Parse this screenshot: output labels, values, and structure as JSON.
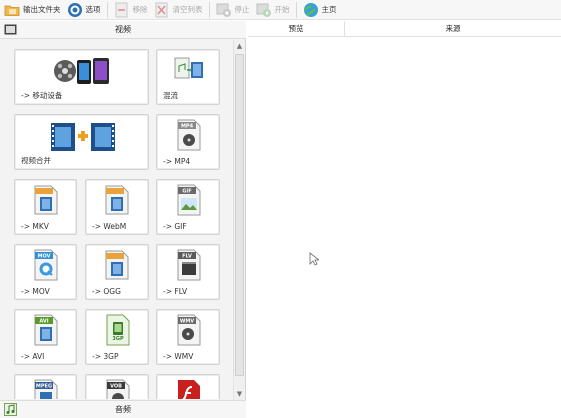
{
  "toolbar": {
    "items": [
      {
        "label": "输出文件夹",
        "icon": "folder-icon",
        "enabled": true
      },
      {
        "label": "选项",
        "icon": "options-icon",
        "enabled": true
      },
      {
        "label": "移除",
        "icon": "remove-icon",
        "enabled": false
      },
      {
        "label": "清空列表",
        "icon": "clear-list-icon",
        "enabled": false
      },
      {
        "label": "停止",
        "icon": "stop-icon",
        "enabled": false
      },
      {
        "label": "开始",
        "icon": "start-icon",
        "enabled": false
      },
      {
        "label": "主页",
        "icon": "home-icon",
        "enabled": true
      }
    ]
  },
  "left_panel": {
    "video_section_title": "视频",
    "audio_section_title": "音频",
    "tiles": [
      {
        "label": "-> 移动设备",
        "icon": "mobile-device-icon"
      },
      {
        "label": "混流",
        "icon": "mux-icon"
      },
      {
        "label": "视频合并",
        "icon": "video-merge-icon"
      },
      {
        "label": "-> MP4",
        "icon": "mp4-file-icon",
        "badge": "MP4"
      },
      {
        "label": "-> MKV",
        "icon": "mkv-file-icon"
      },
      {
        "label": "-> WebM",
        "icon": "webm-file-icon"
      },
      {
        "label": "-> GIF",
        "icon": "gif-file-icon",
        "badge": "GIF"
      },
      {
        "label": "-> MOV",
        "icon": "mov-file-icon",
        "badge": "MOV"
      },
      {
        "label": "-> OGG",
        "icon": "ogg-file-icon"
      },
      {
        "label": "-> FLV",
        "icon": "flv-file-icon",
        "badge": "FLV"
      },
      {
        "label": "-> AVI",
        "icon": "avi-file-icon",
        "badge": "AVI"
      },
      {
        "label": "-> 3GP",
        "icon": "3gp-file-icon",
        "badge": "3GP"
      },
      {
        "label": "-> WMV",
        "icon": "wmv-file-icon",
        "badge": "WMV"
      },
      {
        "label": "",
        "icon": "mpeg-file-icon",
        "badge": "MPEG"
      },
      {
        "label": "",
        "icon": "vob-file-icon",
        "badge": "VOB"
      },
      {
        "label": "",
        "icon": "swf-file-icon"
      }
    ]
  },
  "right_panel": {
    "columns": [
      "预览",
      "来源"
    ]
  },
  "colors": {
    "accent_orange": "#e8a33a",
    "film_blue": "#2f6fb3",
    "disabled_text": "#a8a8a8"
  }
}
